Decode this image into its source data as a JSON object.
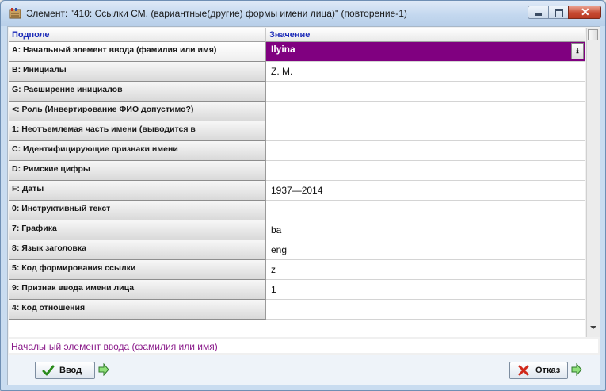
{
  "window": {
    "title": "Элемент: \"410: Ссылки СМ. (вариантные(другие) формы имени лица)\" (повторение-1)"
  },
  "grid": {
    "columns": {
      "field": "Подполе",
      "value": "Значение"
    },
    "rows": [
      {
        "field": "A: Начальный элемент ввода (фамилия или имя)",
        "value": "Ilyina"
      },
      {
        "field": "B: Инициалы",
        "value": "Z. M."
      },
      {
        "field": "G: Расширение инициалов",
        "value": ""
      },
      {
        "field": "<: Роль (Инвертирование ФИО допустимо?)",
        "value": ""
      },
      {
        "field": "1: Неотъемлемая часть имени (выводится в",
        "value": ""
      },
      {
        "field": "C: Идентифицирующие признаки имени",
        "value": ""
      },
      {
        "field": "D: Римские цифры",
        "value": ""
      },
      {
        "field": "F: Даты",
        "value": "1937—2014"
      },
      {
        "field": "0: Инструктивный текст",
        "value": ""
      },
      {
        "field": "7: Графика",
        "value": "ba"
      },
      {
        "field": "8: Язык заголовка",
        "value": "eng"
      },
      {
        "field": "5: Код формирования ссылки",
        "value": "z"
      },
      {
        "field": "9: Признак ввода имени лица",
        "value": "1"
      },
      {
        "field": "4: Код отношения",
        "value": ""
      }
    ]
  },
  "status": {
    "text": "Начальный элемент ввода (фамилия или имя)"
  },
  "buttons": {
    "ok": "Ввод",
    "cancel": "Отказ"
  },
  "colors": {
    "selected_bg": "#800080",
    "header_text": "#1c2bb8",
    "status_text": "#8a1a8a"
  },
  "icons": {
    "app": "app-book-icon",
    "ok": "checkmark-icon",
    "cancel": "red-x-icon",
    "next": "green-arrow-right-icon"
  }
}
